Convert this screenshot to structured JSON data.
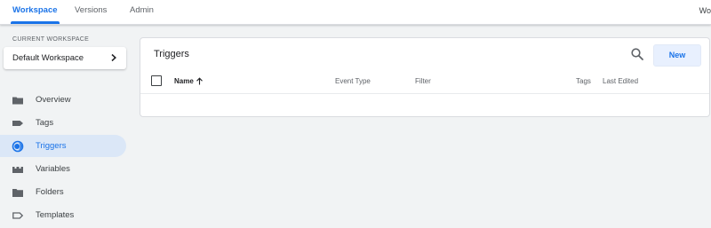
{
  "topnav": {
    "tabs": [
      {
        "label": "Workspace",
        "active": true
      },
      {
        "label": "Versions",
        "active": false
      },
      {
        "label": "Admin",
        "active": false
      }
    ],
    "right_text": "Wo"
  },
  "sidebar": {
    "current_workspace_label": "CURRENT WORKSPACE",
    "workspace_name": "Default Workspace",
    "items": [
      {
        "label": "Overview",
        "icon": "folder-icon",
        "active": false
      },
      {
        "label": "Tags",
        "icon": "tag-icon",
        "active": false
      },
      {
        "label": "Triggers",
        "icon": "trigger-icon",
        "active": true
      },
      {
        "label": "Variables",
        "icon": "variables-icon",
        "active": false
      },
      {
        "label": "Folders",
        "icon": "folder-icon",
        "active": false
      },
      {
        "label": "Templates",
        "icon": "template-icon",
        "active": false
      }
    ]
  },
  "main": {
    "title": "Triggers",
    "new_button": "New",
    "columns": [
      "Name",
      "Event Type",
      "Filter",
      "Tags",
      "Last Edited"
    ],
    "sort_icon": "arrow-up-icon"
  },
  "colors": {
    "accent": "#1a73e8",
    "active_bg": "#dbe7f7",
    "page_bg": "#f1f3f4"
  }
}
